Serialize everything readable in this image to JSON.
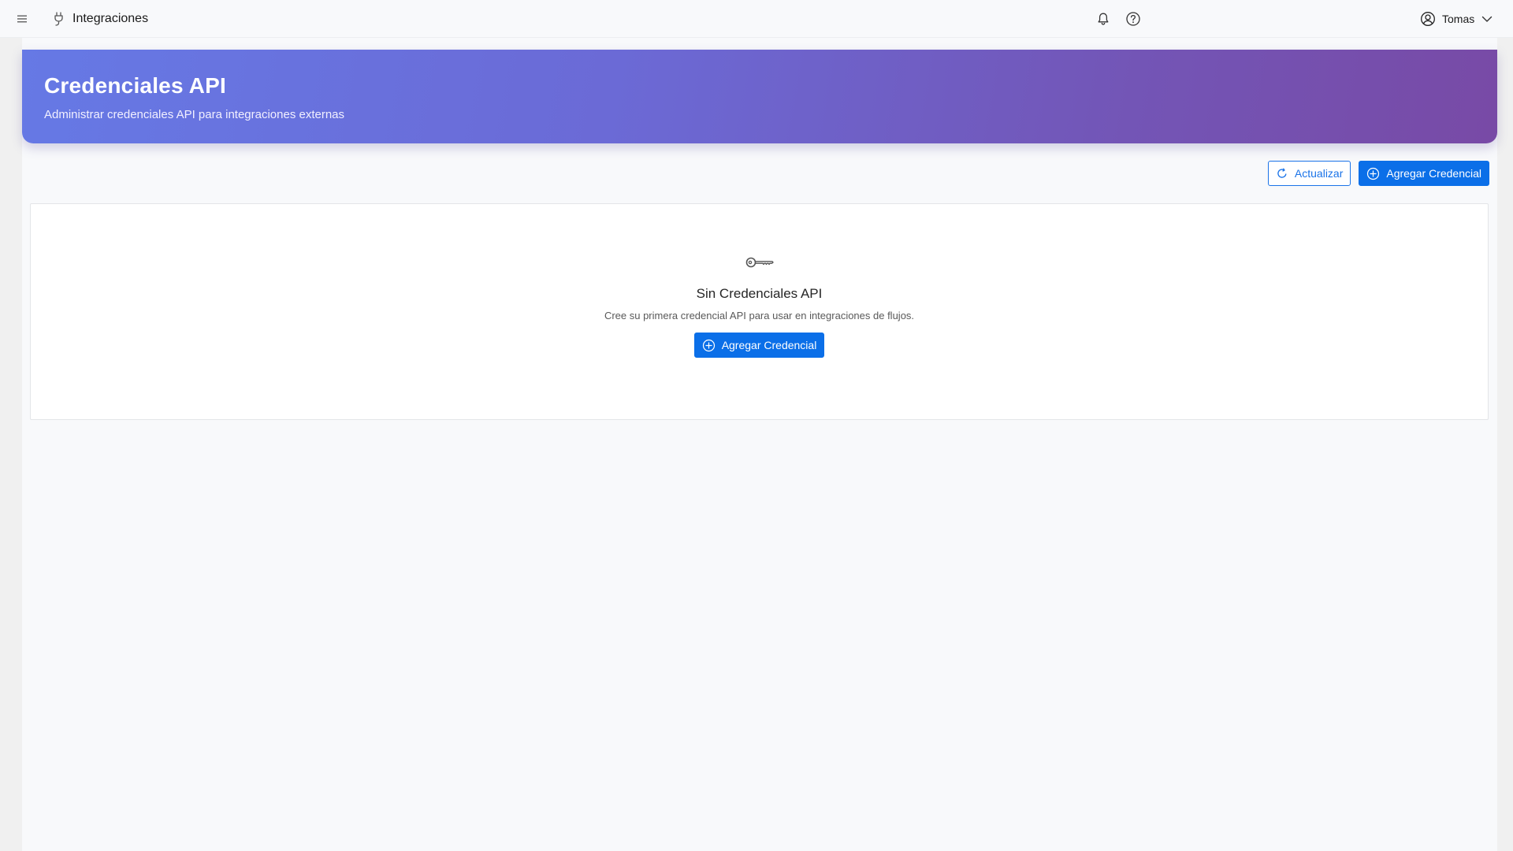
{
  "header": {
    "app_title": "Integraciones",
    "user_name": "Tomas",
    "icons": [
      "menu-icon",
      "plug-icon",
      "bell-icon",
      "help-icon",
      "user-icon",
      "chevron-down-icon"
    ]
  },
  "hero": {
    "title": "Credenciales API",
    "subtitle": "Administrar credenciales API para integraciones externas"
  },
  "toolbar": {
    "refresh_label": "Actualizar",
    "add_label": "Agregar Credencial"
  },
  "empty_state": {
    "icon": "key-icon",
    "title": "Sin Credenciales API",
    "description": "Cree su primera credencial API para usar en integraciones de flujos.",
    "cta_label": "Agregar Credencial"
  },
  "colors": {
    "primary": "#0b6fe8",
    "hero_gradient_start": "#6679e5",
    "hero_gradient_end": "#784aa6"
  }
}
